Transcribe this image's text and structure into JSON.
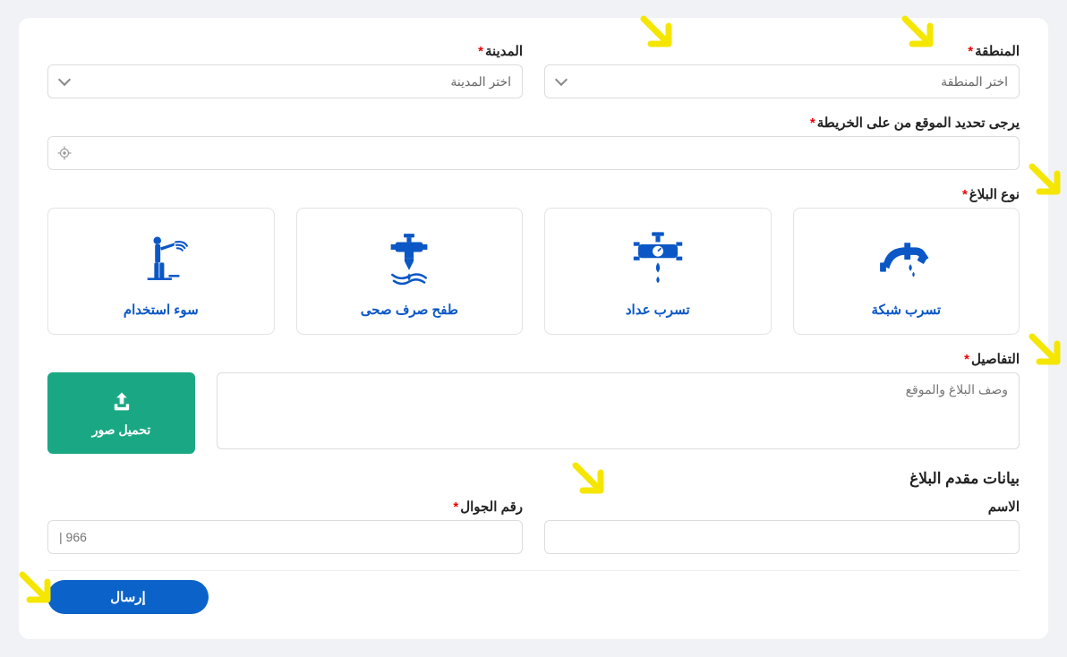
{
  "region": {
    "label": "المنطقة",
    "placeholder": "اختر المنطقة"
  },
  "city": {
    "label": "المدينة",
    "placeholder": "اختر المدينة"
  },
  "map": {
    "label": "يرجى تحديد الموقع من على الخريطة"
  },
  "reportType": {
    "label": "نوع البلاغ",
    "options": [
      {
        "key": "misuse",
        "label": "سوء استخدام"
      },
      {
        "key": "sewage",
        "label": "طفح صرف صحى"
      },
      {
        "key": "meterleak",
        "label": "تسرب عداد"
      },
      {
        "key": "networkleak",
        "label": "تسرب شبكة"
      }
    ]
  },
  "details": {
    "label": "التفاصيل",
    "placeholder": "وصف البلاغ والموقع"
  },
  "upload": {
    "label": "تحميل صور"
  },
  "reporter": {
    "section": "بيانات مقدم البلاغ",
    "name_label": "الاسم",
    "phone_label": "رقم الجوال",
    "phone_placeholder": "| 966"
  },
  "submit": {
    "label": "إرسال"
  }
}
